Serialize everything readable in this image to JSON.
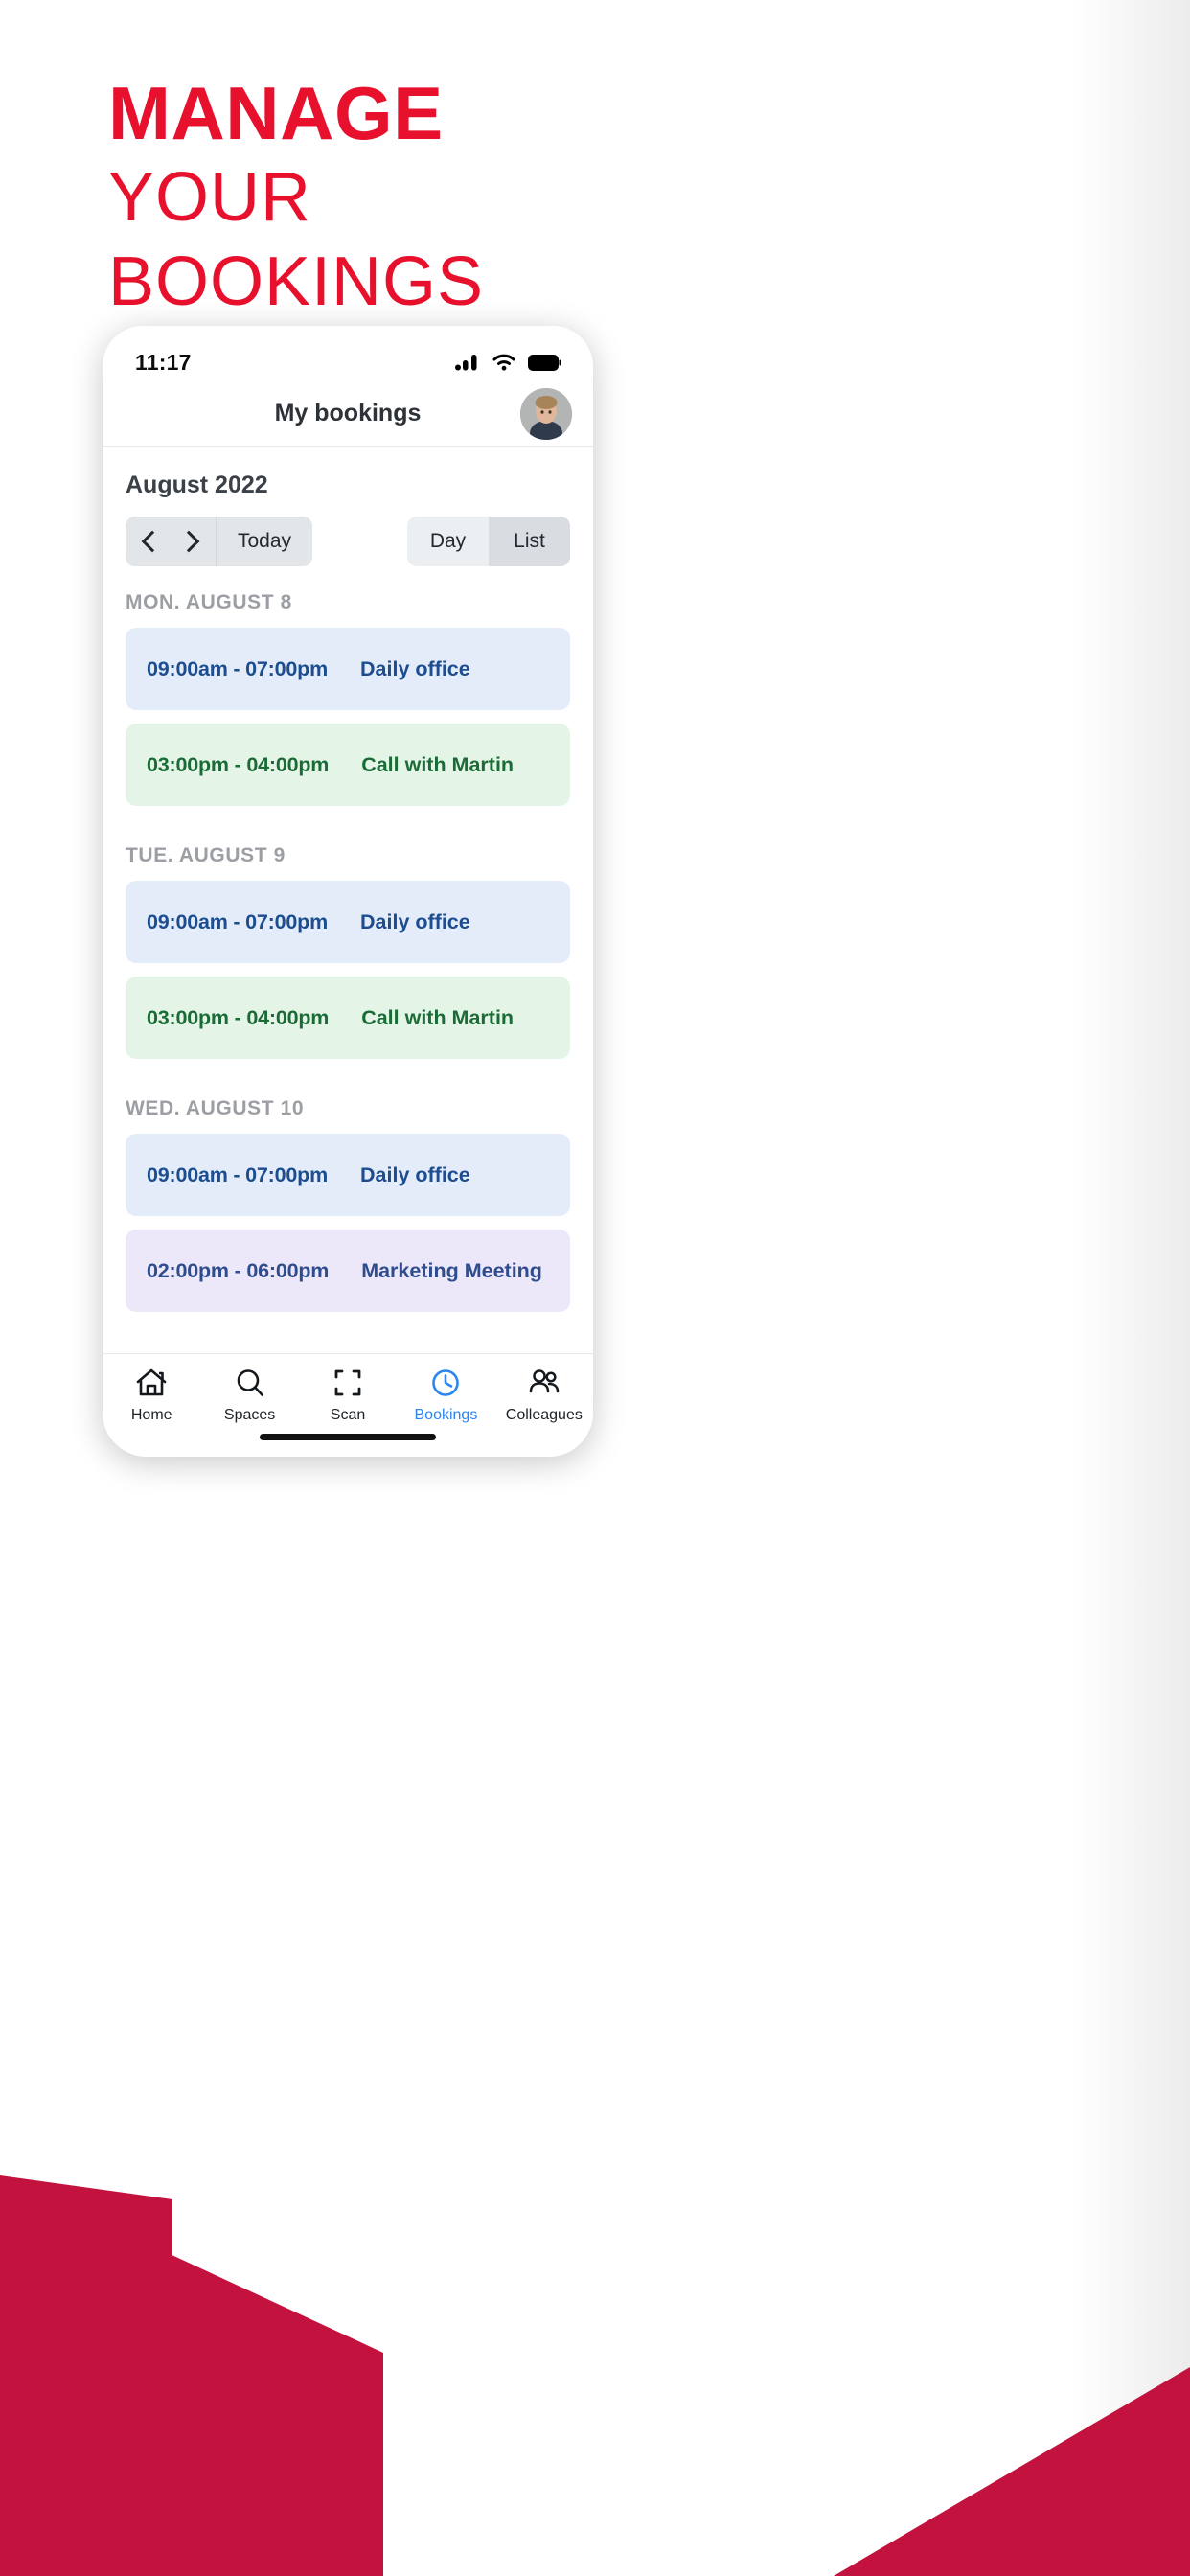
{
  "promo": {
    "line1": "MANAGE",
    "line2": "YOUR",
    "line3": "BOOKINGS",
    "accent_color": "#E8112D",
    "corner_color": "#C4123F"
  },
  "status_bar": {
    "time": "11:17",
    "icons": [
      "cellular-signal-icon",
      "wifi-icon",
      "battery-icon"
    ]
  },
  "app_header": {
    "title": "My bookings",
    "avatar_name": "user-avatar"
  },
  "calendar": {
    "month_label": "August 2022",
    "prev_icon": "chevron-left-icon",
    "next_icon": "chevron-right-icon",
    "today_label": "Today",
    "view_modes": [
      {
        "label": "Day",
        "selected": false
      },
      {
        "label": "List",
        "selected": true
      }
    ]
  },
  "days": [
    {
      "header": "MON. AUGUST 8",
      "bookings": [
        {
          "time": "09:00am - 07:00pm",
          "title": "Daily office",
          "color": "blue"
        },
        {
          "time": "03:00pm - 04:00pm",
          "title": "Call with Martin",
          "color": "green"
        }
      ]
    },
    {
      "header": "TUE. AUGUST 9",
      "bookings": [
        {
          "time": "09:00am - 07:00pm",
          "title": "Daily office",
          "color": "blue"
        },
        {
          "time": "03:00pm - 04:00pm",
          "title": "Call with Martin",
          "color": "green"
        }
      ]
    },
    {
      "header": "WED. AUGUST 10",
      "bookings": [
        {
          "time": "09:00am - 07:00pm",
          "title": "Daily office",
          "color": "blue"
        },
        {
          "time": "02:00pm - 06:00pm",
          "title": "Marketing Meeting",
          "color": "purple"
        }
      ]
    }
  ],
  "tabbar": {
    "active_color": "#2B86F0",
    "items": [
      {
        "label": "Home",
        "icon": "home-icon",
        "active": false
      },
      {
        "label": "Spaces",
        "icon": "search-icon",
        "active": false
      },
      {
        "label": "Scan",
        "icon": "scan-icon",
        "active": false
      },
      {
        "label": "Bookings",
        "icon": "clock-icon",
        "active": true
      },
      {
        "label": "Colleagues",
        "icon": "people-icon",
        "active": false
      }
    ]
  }
}
